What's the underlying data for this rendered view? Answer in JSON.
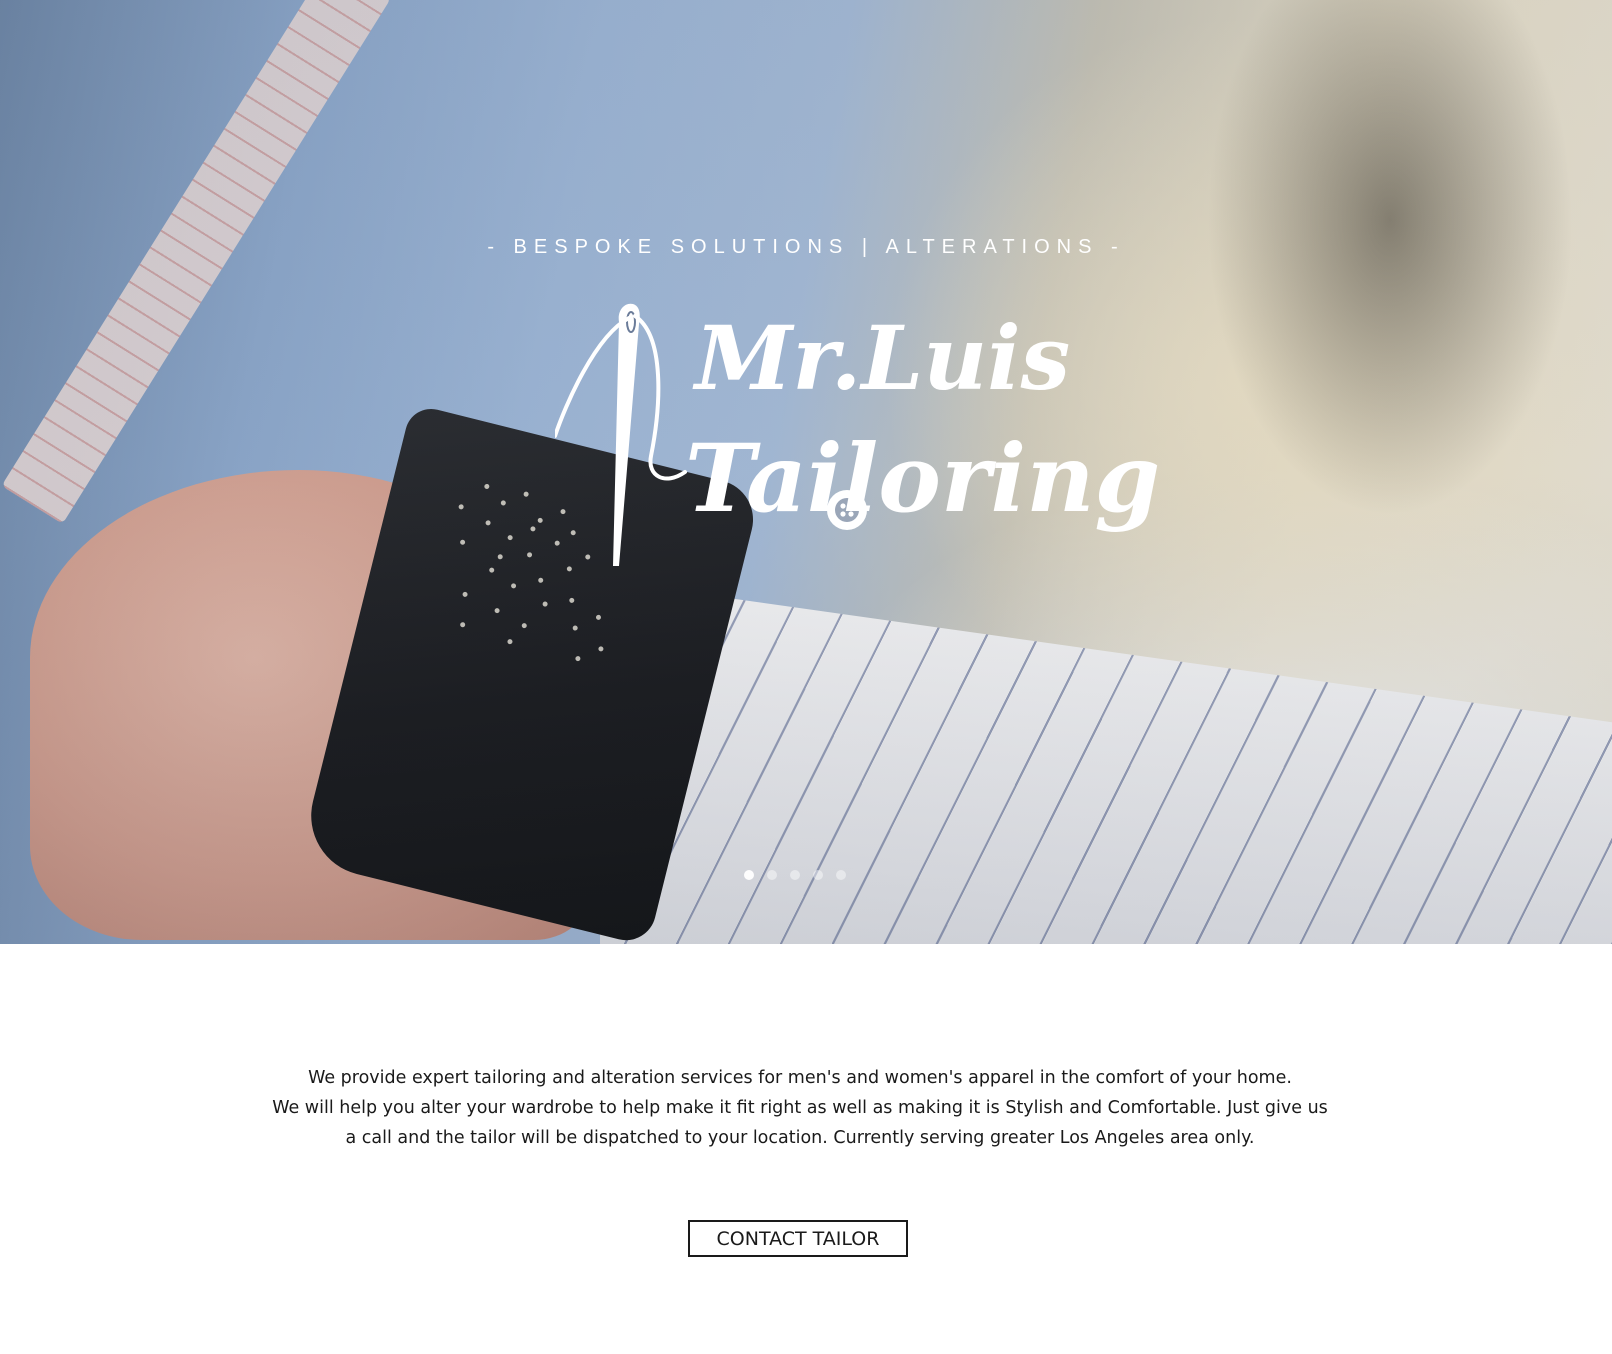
{
  "hero": {
    "tagline": "- BESPOKE SOLUTIONS | ALTERATIONS -",
    "logo_line1": "Mr.Luis",
    "logo_line2": "Tailoring",
    "logo_icon": "needle-and-thread-icon",
    "slideshow": {
      "slide_count": 5,
      "active_index": 0
    }
  },
  "content": {
    "description": [
      "We provide expert tailoring and alteration services for men's and women's apparel in the comfort of your home.",
      "We will help you alter your wardrobe to help make it fit right as well as making it is Stylish and Comfortable. Just give us",
      "a call and the tailor will be dispatched to your location. Currently serving greater Los Angeles area only."
    ],
    "contact_button_label": "CONTACT TAILOR"
  },
  "colors": {
    "text": "#1a1a1a",
    "hero_text": "#ffffff",
    "background": "#ffffff"
  }
}
